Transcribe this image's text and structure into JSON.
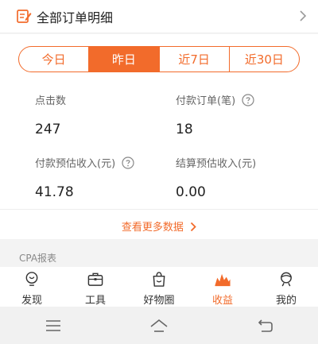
{
  "header": {
    "title": "全部订单明细"
  },
  "tabs": [
    {
      "label": "今日",
      "active": false
    },
    {
      "label": "昨日",
      "active": true
    },
    {
      "label": "近7日",
      "active": false
    },
    {
      "label": "近30日",
      "active": false
    }
  ],
  "stats": {
    "clicks": {
      "label": "点击数",
      "value": "247"
    },
    "paid_orders": {
      "label": "付款订单(笔)",
      "value": "18"
    },
    "est_income": {
      "label": "付款预估收入(元)",
      "value": "41.78"
    },
    "settle_income": {
      "label": "结算预估收入(元)",
      "value": "0.00"
    }
  },
  "more_link": "查看更多数据",
  "section_label": "CPA报表",
  "nav": [
    {
      "label": "发现",
      "icon": "bulb-icon",
      "active": false
    },
    {
      "label": "工具",
      "icon": "toolbox-icon",
      "active": false
    },
    {
      "label": "好物圈",
      "icon": "bag-icon",
      "active": false
    },
    {
      "label": "收益",
      "icon": "chart-icon",
      "active": true
    },
    {
      "label": "我的",
      "icon": "person-icon",
      "active": false
    }
  ],
  "colors": {
    "accent": "#f26b2b"
  }
}
